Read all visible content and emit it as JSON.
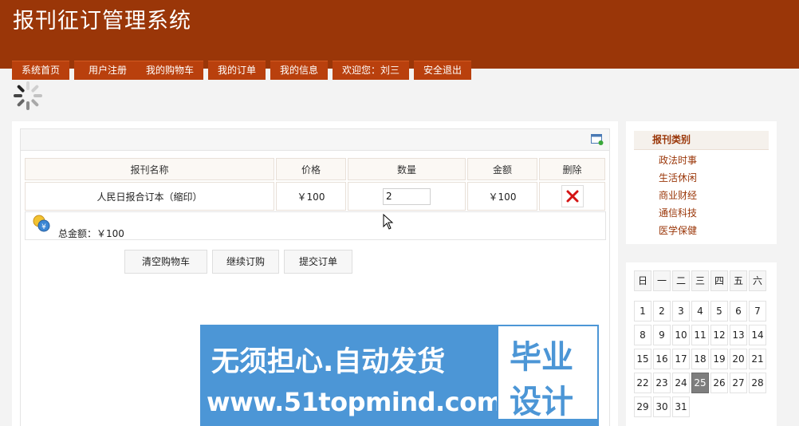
{
  "header": {
    "title": "报刊征订管理系统",
    "nav": [
      "系统首页",
      "用户注册",
      "我的购物车",
      "我的订单",
      "我的信息",
      "欢迎您：刘三",
      "安全退出"
    ]
  },
  "cart": {
    "columns": [
      "报刊名称",
      "价格",
      "数量",
      "金额",
      "删除"
    ],
    "rows": [
      {
        "name": "人民日报合订本（缩印）",
        "price": "￥100",
        "quantity": "2",
        "amount": "￥100"
      }
    ],
    "total": "总金额：￥100",
    "buttons": [
      "清空购物车",
      "继续订购",
      "提交订单"
    ]
  },
  "sidebar": {
    "category_title": "报刊类别",
    "categories": [
      "政法时事",
      "生活休闲",
      "商业财经",
      "通信科技",
      "医学保健"
    ]
  },
  "calendar": {
    "weekdays": [
      "日",
      "一",
      "二",
      "三",
      "四",
      "五",
      "六"
    ],
    "days": [
      "1",
      "2",
      "3",
      "4",
      "5",
      "6",
      "7",
      "8",
      "9",
      "10",
      "11",
      "12",
      "13",
      "14",
      "15",
      "16",
      "17",
      "18",
      "19",
      "20",
      "21",
      "22",
      "23",
      "24",
      "25",
      "26",
      "27",
      "28",
      "29",
      "30",
      "31"
    ],
    "today": "25"
  },
  "banner": {
    "line1": "无须担心.自动发货",
    "url": "www.51topmind.com",
    "right1": "毕业",
    "right2": "设计"
  },
  "colors": {
    "brand": "#9a3608",
    "nav": "#b9400d",
    "banner": "#4c96d6"
  }
}
